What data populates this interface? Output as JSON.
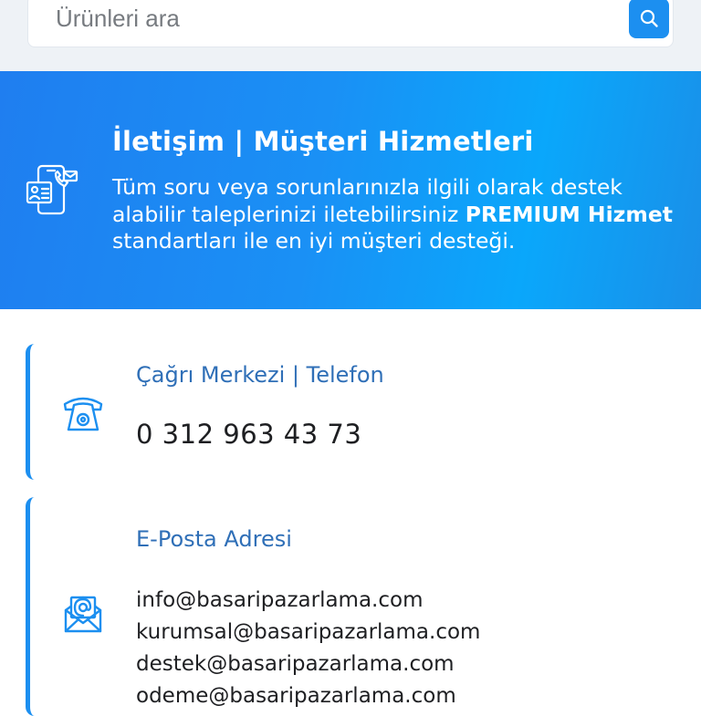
{
  "search": {
    "placeholder": "Ürünleri ara",
    "button_icon": "search-icon"
  },
  "hero": {
    "icon": "contact-phone-mail-icon",
    "title": "İletişim | Müşteri Hizmetleri",
    "description_lead": "Tüm soru veya sorunlarınızla ilgili olarak destek alabilir taleplerinizi iletebilirsiniz ",
    "description_strong": "PREMIUM Hizmet",
    "description_tail": " standartları ile en iyi müşteri desteği."
  },
  "phone_card": {
    "icon": "telephone-icon",
    "title": "Çağrı Merkezi | Telefon",
    "number": "0 312 963 43 73"
  },
  "email_card": {
    "icon": "mail-envelope-icon",
    "title": "E-Posta Adresi",
    "addresses": [
      "info@basaripazarlama.com",
      "kurumsal@basaripazarlama.com",
      "destek@basaripazarlama.com",
      "odeme@basaripazarlama.com"
    ]
  },
  "colors": {
    "accent": "#1c8ff0",
    "hero_gradient_start": "#1f7ef0",
    "hero_gradient_end": "#0aa7fb",
    "card_title": "#2f6fb7",
    "search_background": "#eef2f6"
  }
}
